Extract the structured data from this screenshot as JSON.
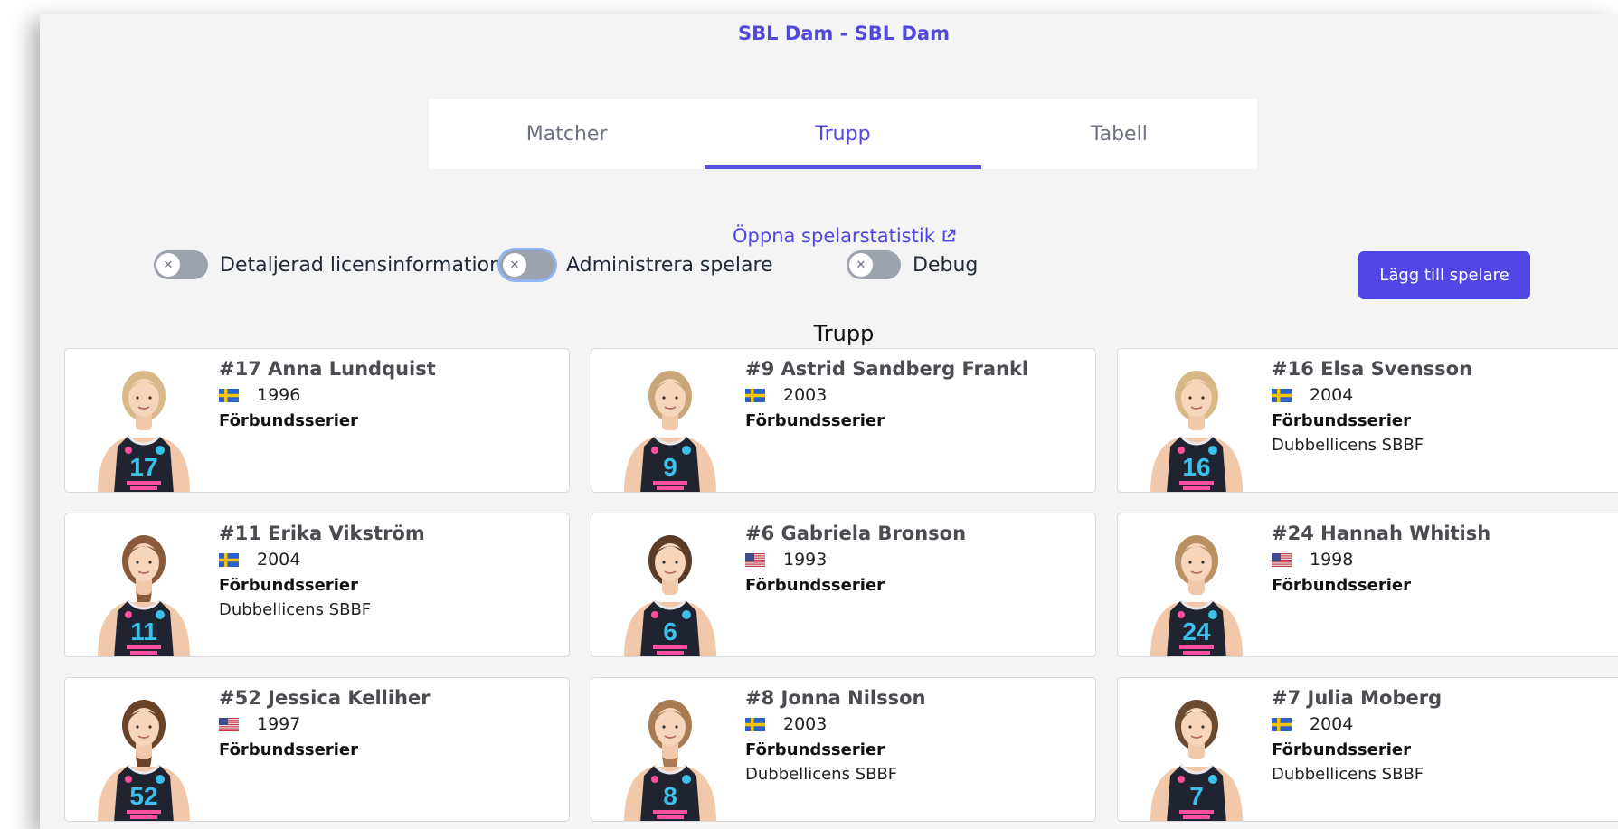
{
  "header": {
    "title": "SBL Dam - SBL Dam"
  },
  "tabs": [
    {
      "label": "Matcher",
      "active": false
    },
    {
      "label": "Trupp",
      "active": true
    },
    {
      "label": "Tabell",
      "active": false
    }
  ],
  "controls": {
    "stats_link": "Öppna spelarstatistik",
    "toggle_license": "Detaljerad licensinformation",
    "toggle_admin": "Administrera spelare",
    "toggle_debug": "Debug",
    "add_player": "Lägg till spelare"
  },
  "section_title": "Trupp",
  "players": [
    {
      "name": "#17 Anna Lundquist",
      "nation": "se",
      "year": "1996",
      "league": "Förbundsserier",
      "license": "",
      "number": "17",
      "hair": "#d9b98a",
      "ponytail": false
    },
    {
      "name": "#9 Astrid Sandberg Frankl",
      "nation": "se",
      "year": "2003",
      "league": "Förbundsserier",
      "license": "",
      "number": "9",
      "hair": "#c9a67a",
      "ponytail": false
    },
    {
      "name": "#16 Elsa Svensson",
      "nation": "se",
      "year": "2004",
      "league": "Förbundsserier",
      "license": "Dubbellicens SBBF",
      "number": "16",
      "hair": "#d8b786",
      "ponytail": false
    },
    {
      "name": "#11 Erika Vikström",
      "nation": "se",
      "year": "2004",
      "league": "Förbundsserier",
      "license": "Dubbellicens SBBF",
      "number": "11",
      "hair": "#8a5a3a",
      "ponytail": true
    },
    {
      "name": "#6 Gabriela Bronson",
      "nation": "us",
      "year": "1993",
      "league": "Förbundsserier",
      "license": "",
      "number": "6",
      "hair": "#5b3a26",
      "ponytail": false
    },
    {
      "name": "#24 Hannah Whitish",
      "nation": "us",
      "year": "1998",
      "league": "Förbundsserier",
      "license": "",
      "number": "24",
      "hair": "#b89062",
      "ponytail": false
    },
    {
      "name": "#52 Jessica Kelliher",
      "nation": "us",
      "year": "1997",
      "league": "Förbundsserier",
      "license": "",
      "number": "52",
      "hair": "#6a4228",
      "ponytail": true
    },
    {
      "name": "#8 Jonna Nilsson",
      "nation": "se",
      "year": "2003",
      "league": "Förbundsserier",
      "license": "Dubbellicens SBBF",
      "number": "8",
      "hair": "#a97b52",
      "ponytail": true
    },
    {
      "name": "#7 Julia Moberg",
      "nation": "se",
      "year": "2004",
      "league": "Förbundsserier",
      "license": "Dubbellicens SBBF",
      "number": "7",
      "hair": "#6b4a32",
      "ponytail": false
    }
  ],
  "colors": {
    "accent": "#4f46e5",
    "jersey": "#1f2430",
    "jersey_number": "#3cc0ec",
    "sponsor_pink": "#ff4fa3"
  }
}
